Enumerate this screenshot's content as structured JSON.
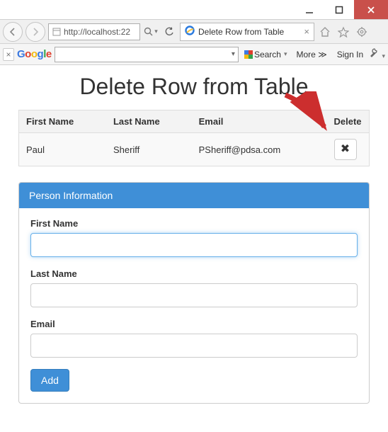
{
  "window": {
    "url": "http://localhost:22",
    "tab_title": "Delete Row from Table"
  },
  "google_toolbar": {
    "search_label": "Search",
    "more_label": "More ≫",
    "signin_label": "Sign In"
  },
  "page": {
    "title": "Delete Row from Table"
  },
  "table": {
    "headers": {
      "first": "First Name",
      "last": "Last Name",
      "email": "Email",
      "delete": "Delete"
    },
    "rows": [
      {
        "first": "Paul",
        "last": "Sheriff",
        "email": "PSheriff@pdsa.com"
      }
    ]
  },
  "form": {
    "panel_title": "Person Information",
    "first_label": "First Name",
    "last_label": "Last Name",
    "email_label": "Email",
    "first_value": "",
    "last_value": "",
    "email_value": "",
    "submit_label": "Add"
  }
}
